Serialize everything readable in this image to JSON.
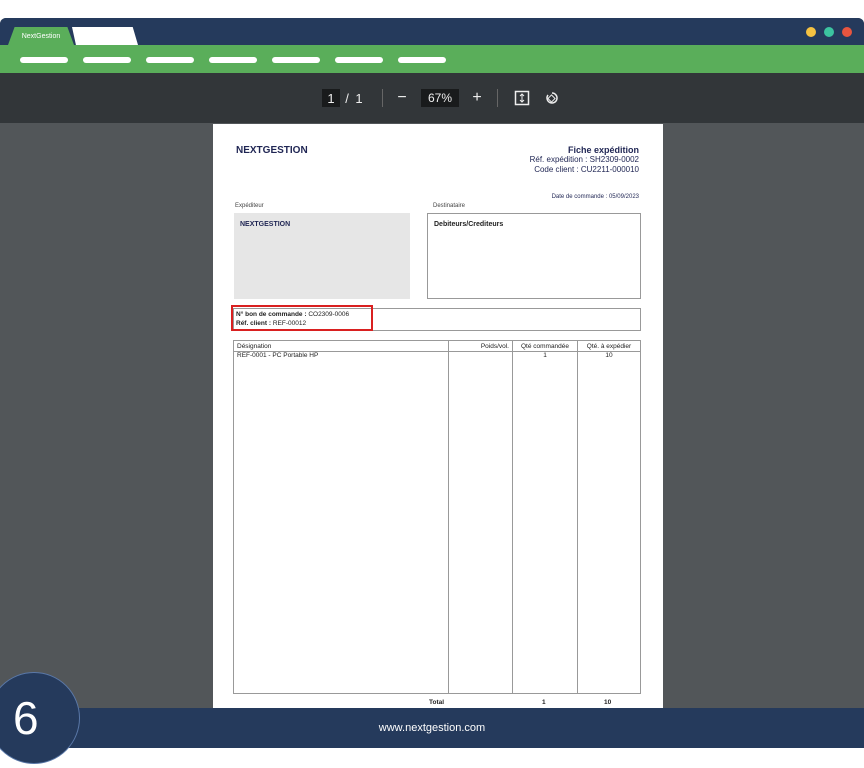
{
  "window": {
    "tab_active": "NextGestion",
    "dots": [
      "#f5c242",
      "#3cc4a0",
      "#e8553f"
    ]
  },
  "toolbar": {
    "page_current": "1",
    "page_sep": "/",
    "page_total": "1",
    "zoom_out": "−",
    "zoom": "67%",
    "zoom_in": "+",
    "fit_icon": "fit-page-icon",
    "rotate_icon": "rotate-icon"
  },
  "doc": {
    "company": "NEXTGESTION",
    "title": "Fiche expédition",
    "ref_exp": "Réf. expédition : SH2309-0002",
    "code_client": "Code client : CU2211-000010",
    "date": "Date de commande : 05/09/2023",
    "sender_label": "Expéditeur",
    "sender_name": "NEXTGESTION",
    "recipient_label": "Destinataire",
    "recipient_name": "Debiteurs/Crediteurs",
    "order_label": "N° bon de commande :",
    "order_value": "CO2309-0006",
    "client_ref_label": "Réf. client :",
    "client_ref_value": "REF-00012",
    "columns": [
      "Désignation",
      "Poids/vol.",
      "Qté commandée",
      "Qté. à expédier"
    ],
    "rows": [
      {
        "designation": "REF-0001 - PC Portable HP",
        "poids": "",
        "qte_cmd": "1",
        "qte_exp": "10"
      }
    ],
    "total_label": "Total",
    "total_cmd": "1",
    "total_exp": "10"
  },
  "footer": {
    "url": "www.nextgestion.com",
    "step": "6"
  }
}
